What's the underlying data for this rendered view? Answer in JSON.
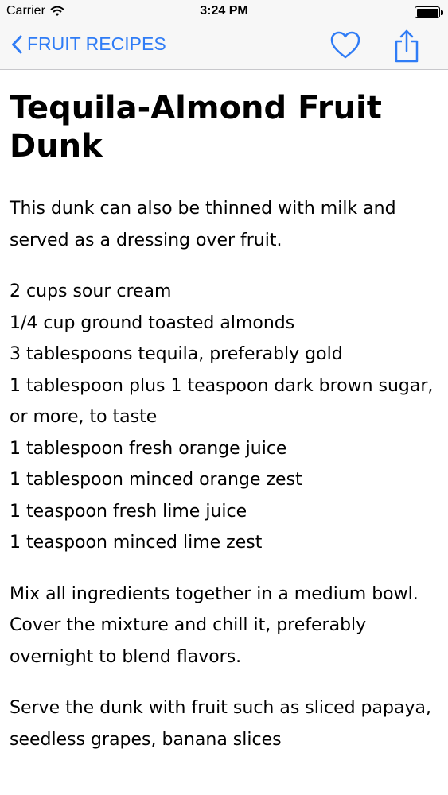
{
  "status_bar": {
    "carrier": "Carrier",
    "time": "3:24 PM"
  },
  "nav": {
    "back_label": "FRUIT RECIPES",
    "accent_color": "#2f7cf6",
    "icons": [
      "chevron-left-icon",
      "heart-icon",
      "share-icon"
    ]
  },
  "recipe": {
    "title": "Tequila-Almond Fruit Dunk",
    "intro": "This dunk can also be thinned with milk and served as a dressing over fruit.",
    "ingredients": [
      "2 cups sour cream",
      "1/4 cup ground toasted almonds",
      "3 tablespoons tequila, preferably gold",
      "1 tablespoon plus 1 teaspoon dark brown sugar, or more, to taste",
      "1 tablespoon fresh orange juice",
      "1 tablespoon minced orange zest",
      "1 teaspoon fresh lime juice",
      "1 teaspoon minced lime zest"
    ],
    "method": "Mix all ingredients together in a medium bowl. Cover the mixture and chill it, preferably overnight to blend flavors.",
    "serve": "Serve the dunk with fruit such as sliced papaya, seedless grapes, banana slices"
  }
}
